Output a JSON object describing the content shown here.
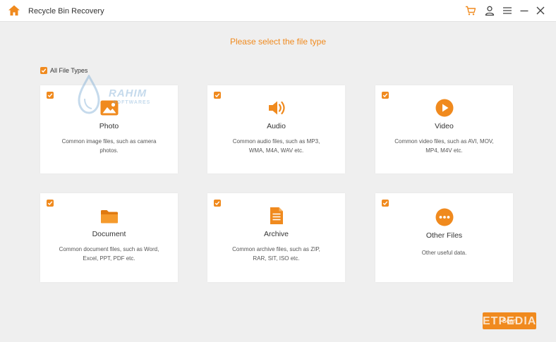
{
  "app": {
    "title": "Recycle Bin Recovery",
    "icons": [
      "home-icon",
      "cart-icon",
      "user-icon",
      "menu-icon",
      "minimize-icon",
      "close-icon"
    ]
  },
  "colors": {
    "accent": "#f08a1e",
    "background": "#efefef",
    "card": "#ffffff"
  },
  "heading": "Please select the file type",
  "all_types": {
    "label": "All File Types",
    "checked": true
  },
  "cards": [
    {
      "title": "Photo",
      "desc": "Common image files, such as camera photos.",
      "icon": "photo-icon",
      "checked": true
    },
    {
      "title": "Audio",
      "desc": "Common audio files, such as MP3, WMA, M4A, WAV etc.",
      "icon": "audio-icon",
      "checked": true
    },
    {
      "title": "Video",
      "desc": "Common video files, such as AVI, MOV, MP4, M4V etc.",
      "icon": "video-icon",
      "checked": true
    },
    {
      "title": "Document",
      "desc": "Common document files, such as Word, Excel, PPT, PDF etc.",
      "icon": "folder-icon",
      "checked": true
    },
    {
      "title": "Archive",
      "desc": "Common archive files, such as ZIP, RAR, SIT, ISO etc.",
      "icon": "archive-icon",
      "checked": true
    },
    {
      "title": "Other Files",
      "desc": "Other useful data.",
      "icon": "more-icon",
      "checked": true
    }
  ],
  "scan_button": "Scan",
  "watermarks": {
    "top_brand": "RAHIM",
    "top_sub": "SOFTWARES",
    "bottom": "ETPEDIA"
  }
}
